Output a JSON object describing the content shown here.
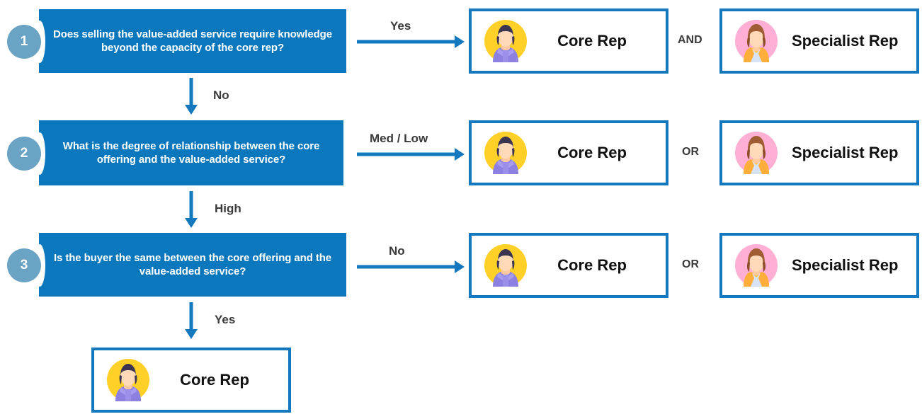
{
  "theme": {
    "box_blue": "#0b78bd",
    "border_blue": "#1478be",
    "badge_blue": "#6ba3c4",
    "label_gray": "#3a3a3a",
    "text_black": "#111111",
    "page_background": "#ffffff"
  },
  "steps": [
    {
      "number": "1",
      "question": "Does selling the value-added service require knowledge beyond the capacity of the core rep?",
      "branch_label": "Yes",
      "join_label": "AND",
      "next_label": "No",
      "outcome_left": "Core Rep",
      "outcome_right": "Specialist Rep"
    },
    {
      "number": "2",
      "question": "What is the degree of relationship between the core offering and the value-added service?",
      "branch_label": "Med / Low",
      "join_label": "OR",
      "next_label": "High",
      "outcome_left": "Core Rep",
      "outcome_right": "Specialist Rep"
    },
    {
      "number": "3",
      "question": "Is the buyer the same between the core offering and the value-added service?",
      "branch_label": "No",
      "join_label": "OR",
      "next_label": "Yes",
      "outcome_left": "Core Rep",
      "outcome_right": "Specialist Rep"
    }
  ],
  "final": {
    "label": "Core Rep"
  },
  "icons": {
    "core_rep_avatar": "male-avatar-icon",
    "specialist_rep_avatar": "female-avatar-icon"
  },
  "avatar_colors": {
    "male_circle": "#ffd028",
    "male_hair": "#3b3551",
    "male_skin": "#ffc9a0",
    "male_shirt": "#8c80e0",
    "female_circle": "#ffaed4",
    "female_hair": "#a05c32",
    "female_skin": "#ffc9a0",
    "female_jacket": "#ffc43d",
    "female_blouse": "#d7e3f4"
  }
}
